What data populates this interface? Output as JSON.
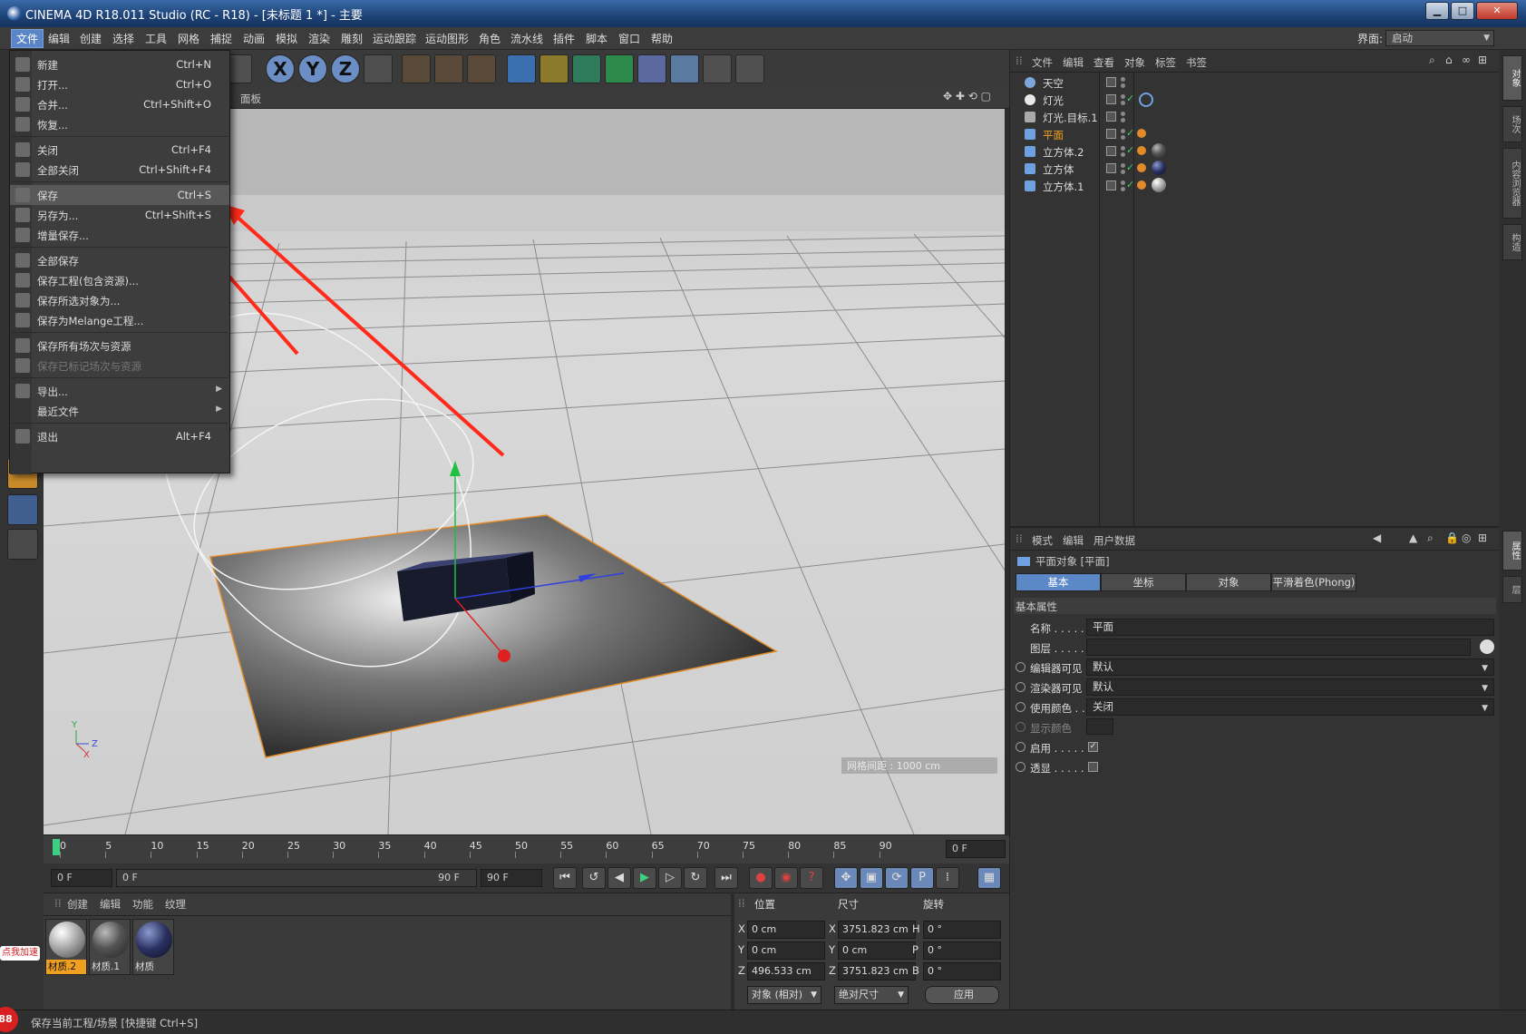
{
  "window": {
    "title": "CINEMA 4D R18.011 Studio (RC - R18) - [未标题 1 *] - 主要",
    "buttons": {
      "minimize": "▁",
      "maximize": "□",
      "close": "✕"
    }
  },
  "menubar": {
    "items": [
      "文件",
      "编辑",
      "创建",
      "选择",
      "工具",
      "网格",
      "捕捉",
      "动画",
      "模拟",
      "渲染",
      "雕刻",
      "运动跟踪",
      "运动图形",
      "角色",
      "流水线",
      "插件",
      "脚本",
      "窗口",
      "帮助"
    ],
    "layout_label": "界面:",
    "layout_value": "启动"
  },
  "toolbar": {
    "axis_x": "X",
    "axis_y": "Y",
    "axis_z": "Z"
  },
  "viewport": {
    "header_label": "面板",
    "grid_spacing": "网格间距 : 1000 cm",
    "axis_y": "Y",
    "axis_z": "Z",
    "axis_x": "X"
  },
  "file_menu": {
    "items": [
      {
        "label": "新建",
        "shortcut": "Ctrl+N"
      },
      {
        "label": "打开...",
        "shortcut": "Ctrl+O"
      },
      {
        "label": "合并...",
        "shortcut": "Ctrl+Shift+O"
      },
      {
        "label": "恢复...",
        "shortcut": ""
      },
      {
        "label": "关闭",
        "shortcut": "Ctrl+F4"
      },
      {
        "label": "全部关闭",
        "shortcut": "Ctrl+Shift+F4"
      },
      {
        "label": "保存",
        "shortcut": "Ctrl+S"
      },
      {
        "label": "另存为...",
        "shortcut": "Ctrl+Shift+S"
      },
      {
        "label": "增量保存...",
        "shortcut": ""
      },
      {
        "label": "全部保存",
        "shortcut": ""
      },
      {
        "label": "保存工程(包含资源)...",
        "shortcut": ""
      },
      {
        "label": "保存所选对象为...",
        "shortcut": ""
      },
      {
        "label": "保存为Melange工程...",
        "shortcut": ""
      },
      {
        "label": "保存所有场次与资源",
        "shortcut": ""
      },
      {
        "label": "保存已标记场次与资源",
        "shortcut": ""
      },
      {
        "label": "导出...",
        "shortcut": ""
      },
      {
        "label": "最近文件",
        "shortcut": ""
      },
      {
        "label": "退出",
        "shortcut": "Alt+F4"
      }
    ],
    "arrow": "▶"
  },
  "timeline": {
    "ticks": [
      "0",
      "5",
      "10",
      "15",
      "20",
      "25",
      "30",
      "35",
      "40",
      "45",
      "50",
      "55",
      "60",
      "65",
      "70",
      "75",
      "80",
      "85",
      "90"
    ],
    "current_frame": "0 F",
    "start_field": "0 F",
    "range_start": "0 F",
    "range_end": "90 F",
    "end_field": "90 F"
  },
  "object_manager": {
    "menu": [
      "文件",
      "编辑",
      "查看",
      "对象",
      "标签",
      "书签"
    ],
    "objects": [
      {
        "name": "天空",
        "color": "#7fa6d8",
        "selected": false
      },
      {
        "name": "灯光",
        "color": "#e8e8e8",
        "selected": false
      },
      {
        "name": "灯光.目标.1",
        "color": "#aaaaaa",
        "selected": false
      },
      {
        "name": "平面",
        "color": "#6fa0e0",
        "selected": true
      },
      {
        "name": "立方体.2",
        "color": "#6fa0e0",
        "selected": false
      },
      {
        "name": "立方体",
        "color": "#6fa0e0",
        "selected": false
      },
      {
        "name": "立方体.1",
        "color": "#6fa0e0",
        "selected": false
      }
    ]
  },
  "attribute_manager": {
    "menu": [
      "模式",
      "编辑",
      "用户数据"
    ],
    "object_title": "平面对象 [平面]",
    "tabs": [
      "基本",
      "坐标",
      "对象",
      "平滑着色(Phong)"
    ],
    "section": "基本属性",
    "fields": {
      "name_label": "名称 . . . . .",
      "name_value": "平面",
      "layer_label": "图层 . . . . .",
      "layer_value": "",
      "editor_vis_label": "编辑器可见",
      "editor_vis_value": "默认",
      "render_vis_label": "渲染器可见",
      "render_vis_value": "默认",
      "use_color_label": "使用颜色 . .",
      "use_color_value": "关闭",
      "display_color_label": "显示颜色",
      "enable_label": "启用 . . . . .",
      "enable_check": "✓",
      "xray_label": "透显 . . . . ."
    }
  },
  "material_manager": {
    "menu": [
      "创建",
      "编辑",
      "功能",
      "纹理"
    ],
    "materials": [
      {
        "name": "材质.2",
        "selected": true
      },
      {
        "name": "材质.1",
        "selected": false
      },
      {
        "name": "材质",
        "selected": false
      }
    ]
  },
  "coord_manager": {
    "headers": [
      "位置",
      "尺寸",
      "旋转"
    ],
    "rows": [
      {
        "axis": "X",
        "pos": "0 cm",
        "size_axis": "X",
        "size": "3751.823 cm",
        "rot_axis": "H",
        "rot": "0 °"
      },
      {
        "axis": "Y",
        "pos": "0 cm",
        "size_axis": "Y",
        "size": "0 cm",
        "rot_axis": "P",
        "rot": "0 °"
      },
      {
        "axis": "Z",
        "pos": "496.533 cm",
        "size_axis": "Z",
        "size": "3751.823 cm",
        "rot_axis": "B",
        "rot": "0 °"
      }
    ],
    "mode_select": "对象 (相对)",
    "size_select": "绝对尺寸",
    "apply": "应用"
  },
  "right_tabs": [
    "对象",
    "场次",
    "内容浏览器",
    "构造",
    "属性",
    "层"
  ],
  "status": {
    "text": "保存当前工程/场景 [快捷键 Ctrl+S]",
    "badge": "88",
    "promo": "点我加速"
  },
  "colors": {
    "accent": "#5a86c9",
    "selected_text": "#f0a020",
    "annotation_arrow": "#ff2a1a"
  }
}
